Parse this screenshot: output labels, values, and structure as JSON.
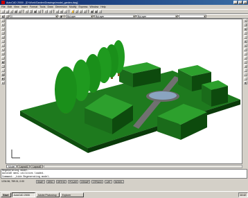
{
  "window": {
    "title": "AutoCAD 2000i - [D:\\Work\\Garden\\Drawings\\model_garden.dwg]",
    "minimize": "_",
    "maximize": "□",
    "close": "×"
  },
  "menu": [
    "File",
    "Edit",
    "View",
    "Insert",
    "Format",
    "Tools",
    "Draw",
    "Dimension",
    "Modify",
    "Express",
    "Window",
    "Help"
  ],
  "toolbar": {
    "layer_value": "0",
    "linetype_value": "ByLayer",
    "lineweight_value": "ByLayer",
    "color_value": "ByLayer"
  },
  "tabs": [
    "Model",
    "Layout1",
    "Layout2"
  ],
  "command_line": {
    "line1": "Regenerating model.",
    "line2": "AutoCAD menu utilities loaded.",
    "line3": "Command: _hide Regenerating model."
  },
  "status": {
    "coords": "1234.56, 789.01, 0.00",
    "buttons": [
      "SNAP",
      "GRID",
      "ORTHO",
      "POLAR",
      "OSNAP",
      "OTRACK",
      "LWT",
      "MODEL"
    ]
  },
  "taskbar": {
    "start": "Start",
    "tasks": [
      "AutoCAD 2000i",
      "Adobe Photoshop",
      "Explorer"
    ],
    "time": "10:42"
  },
  "colors": {
    "ground": "#1e7a1e",
    "ground_side": "#0f4f0f",
    "hedge_top": "#2da02d",
    "hedge_front": "#1a6b1a",
    "hedge_side": "#0d4a0d",
    "tree": "#1f9a1f",
    "trunk": "#7a5a1a",
    "path": "#707070",
    "pool": "#8aa4c0"
  }
}
